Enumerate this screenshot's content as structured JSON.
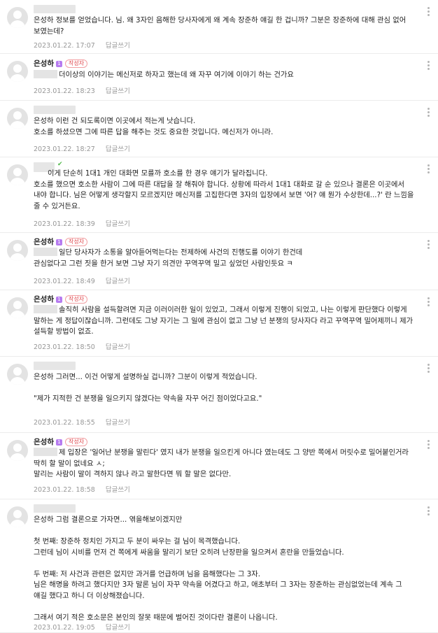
{
  "comments": [
    {
      "nickname": "",
      "text": "은성하 정보를 얻었습니다. 님. 왜 3자인 음해한 당사자에게 왜 계속 장준하 얘길 한 겁니까? 그분은 장준하에 대해 관심 없어 보였는데?",
      "date": "2023.01.22. 17:07",
      "reply": "답글쓰기"
    },
    {
      "nickname": "은성하",
      "level": "1",
      "badge": "작성자",
      "text": "더이상의 이야기는 메신저로 하자고 했는데 왜 자꾸 여기에 이야기 하는 건가요",
      "date": "2023.01.22. 18:23",
      "reply": "답글쓰기"
    },
    {
      "nickname": "",
      "text": "은성하 이런 건 되도록이면 이곳에서 적는게 낫습니다.\n호소를 하셨으면 그에 따른 답을 해주는 것도 중요한 것입니다. 메신저가 아니라.",
      "date": "2023.01.22. 18:27",
      "reply": "답글쓰기"
    },
    {
      "nickname": "",
      "text": "이게 단순히 1대1 개인 대화면 모를까 호소를 한 경우 얘기가 달라집니다.\n호소를 했으면 호소한 사람이 그에 따른 대답을 잘 해줘야 합니다. 상황에 따라서 1대1 대화로 갈 순 있으나 결론은 이곳에서 내야 합니다. 님은 어떻게 생각할지 모르겠지만 메신저를 고집한다면 3자의 입장에서 보면 '어? 얘 뭔가 수상한데...?' 란 느낌을 줄 수 있거든요.",
      "date": "2023.01.22. 18:39",
      "reply": "답글쓰기"
    },
    {
      "nickname": "은성하",
      "level": "1",
      "badge": "작성자",
      "text": "일단 당사자가 소통을 알아듣어먹는다는 전제하에 사건의 진행도를 이야기 한건데\n관심없다고 그런 짓을 한거 보면 그냥 자기 의견만 꾸역꾸역 밀고 싶었던 사람인듯요 ㅋ",
      "date": "2023.01.22. 18:49",
      "reply": "답글쓰기"
    },
    {
      "nickname": "은성하",
      "level": "1",
      "badge": "작성자",
      "text": "솔직히 사람을 설득할려면 지금 이러이러한 일이 있었고, 그래서 이렇게 진행이 되었고, 나는 이렇게 판단했다 이렇게 말하는 게 정답이잖습니까. 그런데도 그냥 자기는 그 일에 관심이 없고 그냥 넌 분쟁의 당사자다 라고 꾸역꾸역 밀어제끼니 제가 설득할 방법이 없죠.",
      "date": "2023.01.22. 18:50",
      "reply": "답글쓰기"
    },
    {
      "nickname": "",
      "text": "은성하 그러면... 이건 어떻게 설명하실 겁니까? 그분이 이렇게 적었습니다.\n\n\"제가 지적한 건 분쟁을 일으키지 않겠다는 약속을 자꾸 어긴 점이었다고요.\"",
      "date": "2023.01.22. 18:55",
      "reply": "답글쓰기"
    },
    {
      "nickname": "은성하",
      "level": "1",
      "badge": "작성자",
      "text": "제 입장은 '일어난 분쟁을 말린다' 였지 내가 분쟁을 일으킨게 아니다 였는데도 그 양반 쪽에서 머릿수로 밀어붙인거라 딱히 할 말이 없네요 ㅅ;\n말리는 사람이 말이 격하지 않나 라고 말한다면 뭐 할 말은 없다만.",
      "date": "2023.01.22. 18:58",
      "reply": "답글쓰기"
    },
    {
      "nickname": "",
      "text": "은성하 그럼 결론으로 가자면... 엮을해보이겠지만\n\n첫 번째: 장준하 정치인 가지고 두 분이 싸우는 걸 님이 목격했습니다.\n그런데 님이 시비를 먼저 건 쪽에게 싸움을 말리기 보단 오히려 난장판을 일으켜서 혼란을 만들었습니다.\n\n두 번째: 저 사건과 관련은 없지만 과거를 언급하며 님을 음해했다는 그 3자.\n님은 해명을 하려고 했다지만 3자 말론 님이 자꾸 약속을 어겼다고 하고, 애초부터 그 3자는 장준하는 관심없었는데 계속 그 얘길 했다고 하니 더 이상해졌습니다.\n\n그래서 여기 적은 호소문은 본인의 잘못 때문에 벌어진 것이다란 결론이 나옵니다.",
      "date": "2023.01.22. 19:05",
      "reply": "답글쓰기"
    }
  ]
}
